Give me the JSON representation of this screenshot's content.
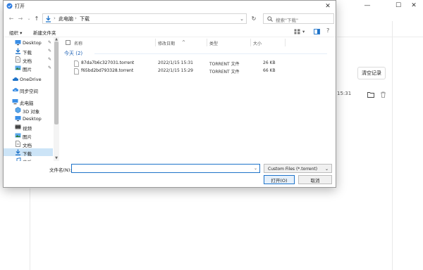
{
  "background": {
    "window_controls": [
      "—",
      "☐",
      "✕"
    ],
    "clear_button": "清空记录",
    "time_fragment": "15:31"
  },
  "dialog": {
    "title": "打开",
    "close": "✕",
    "address": {
      "crumbs": [
        "此电脑",
        "下载"
      ],
      "separator": "›"
    },
    "search_placeholder": "搜索\"下载\"",
    "toolbar": {
      "organize": "组织 ▾",
      "new_folder": "新建文件夹"
    },
    "nav_items": [
      {
        "label": "Desktop",
        "icon": "desktop-icon",
        "pinned": true
      },
      {
        "label": "下载",
        "icon": "download-icon",
        "pinned": true
      },
      {
        "label": "文档",
        "icon": "document-icon",
        "pinned": true
      },
      {
        "label": "图片",
        "icon": "picture-icon",
        "pinned": true
      },
      {
        "label": "OneDrive",
        "icon": "cloud-icon",
        "pinned": false
      },
      {
        "label": "同步空间",
        "icon": "sync-space-icon",
        "pinned": false
      },
      {
        "label": "此电脑",
        "icon": "computer-icon",
        "pinned": false
      },
      {
        "label": "3D 对象",
        "icon": "3d-objects-icon",
        "pinned": false
      },
      {
        "label": "Desktop",
        "icon": "desktop-icon",
        "pinned": false
      },
      {
        "label": "视频",
        "icon": "video-icon",
        "pinned": false
      },
      {
        "label": "图片",
        "icon": "picture-icon",
        "pinned": false
      },
      {
        "label": "文档",
        "icon": "document-icon",
        "pinned": false
      },
      {
        "label": "下载",
        "icon": "download-icon",
        "pinned": false,
        "selected": true
      },
      {
        "label": "音乐",
        "icon": "music-icon",
        "pinned": false
      }
    ],
    "pin_glyph": "✎",
    "columns": {
      "name": "名称",
      "date": "修改日期",
      "type": "类型",
      "size": "大小"
    },
    "group_label": "今天 (2)",
    "files": [
      {
        "name": "87da7b6c327031.torrent",
        "date": "2022/1/15 15:31",
        "type": "TORRENT 文件",
        "size": "26 KB"
      },
      {
        "name": "f65bd2bd793328.torrent",
        "date": "2022/1/15 15:29",
        "type": "TORRENT 文件",
        "size": "66 KB"
      }
    ],
    "filename_label": "文件名(N):",
    "filename_value": "",
    "filetype": "Custom Files (*.torrent)",
    "open_button": "打开(O)",
    "cancel_button": "取消"
  },
  "colors": {
    "accent": "#1e73c9",
    "selected_bg": "#cce4f7",
    "group_text": "#1a5fb4"
  }
}
